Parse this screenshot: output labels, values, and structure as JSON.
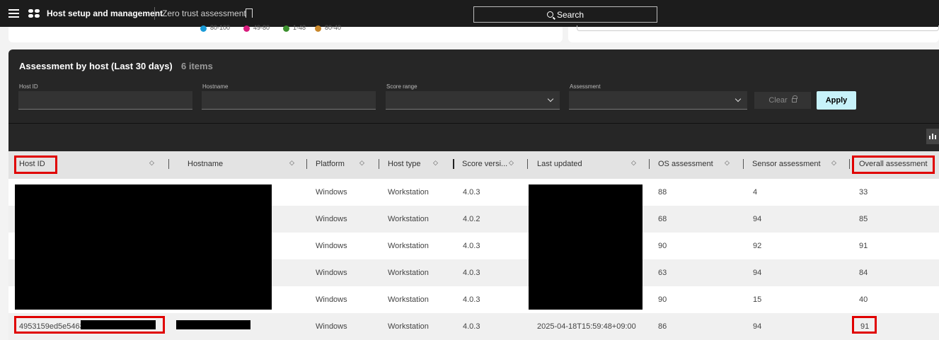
{
  "topbar": {
    "app_title": "Host setup and management",
    "page_title": "Zero trust assessment",
    "search_label": "Search"
  },
  "chart_legend": {
    "items": [
      {
        "label": "80-100",
        "color": "#1a9bd7"
      },
      {
        "label": "49-80",
        "color": "#d81b7c"
      },
      {
        "label": "1-48",
        "color": "#3b8f2d"
      },
      {
        "label": "80-40",
        "color": "#c8872a"
      }
    ]
  },
  "panel": {
    "title": "Assessment by host (Last 30 days)",
    "count": "6 items"
  },
  "filters": {
    "host_id_label": "Host ID",
    "hostname_label": "Hostname",
    "score_range_label": "Score range",
    "assessment_label": "Assessment",
    "clear_label": "Clear",
    "apply_label": "Apply"
  },
  "columns": [
    "Host ID",
    "Hostname",
    "Platform",
    "Host type",
    "Score versi...",
    "Last updated",
    "OS assessment",
    "Sensor assessment",
    "Overall assessment"
  ],
  "rows": [
    {
      "host_id": "",
      "hostname": "",
      "platform": "Windows",
      "host_type": "Workstation",
      "score_version": "4.0.3",
      "last_updated": "",
      "os": "88",
      "sensor": "4",
      "overall": "33"
    },
    {
      "host_id": "",
      "hostname": "",
      "platform": "Windows",
      "host_type": "Workstation",
      "score_version": "4.0.2",
      "last_updated": "",
      "os": "68",
      "sensor": "94",
      "overall": "85"
    },
    {
      "host_id": "",
      "hostname": "",
      "platform": "Windows",
      "host_type": "Workstation",
      "score_version": "4.0.3",
      "last_updated": "",
      "os": "90",
      "sensor": "92",
      "overall": "91"
    },
    {
      "host_id": "",
      "hostname": "",
      "platform": "Windows",
      "host_type": "Workstation",
      "score_version": "4.0.3",
      "last_updated": "",
      "os": "63",
      "sensor": "94",
      "overall": "84"
    },
    {
      "host_id": "",
      "hostname": "",
      "platform": "Windows",
      "host_type": "Workstation",
      "score_version": "4.0.3",
      "last_updated": "",
      "os": "90",
      "sensor": "15",
      "overall": "40"
    },
    {
      "host_id": "4953159ed5e5463",
      "hostname": "",
      "platform": "Windows",
      "host_type": "Workstation",
      "score_version": "4.0.3",
      "last_updated": "2025-04-18T15:59:48+09:00",
      "os": "86",
      "sensor": "94",
      "overall": "91"
    }
  ],
  "colors": {
    "topbar_bg": "#1c1c1c",
    "panel_bg": "#262626",
    "apply_bg": "#c7f2fa",
    "highlight": "#e00000",
    "row_alt": "#f0f0f0"
  }
}
